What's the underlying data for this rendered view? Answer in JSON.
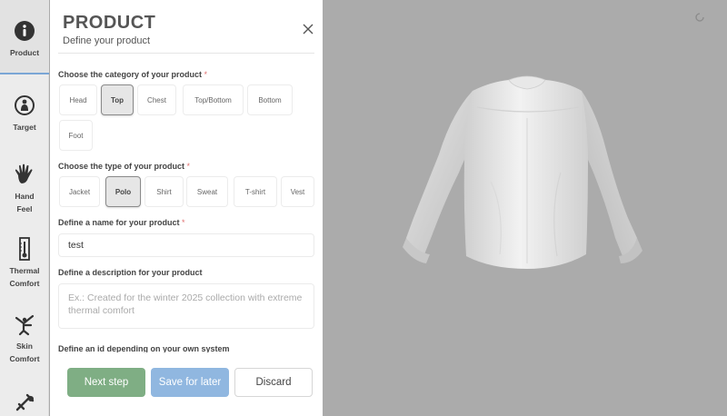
{
  "nav": {
    "items": [
      {
        "label": "Product",
        "icon": "info-icon",
        "active": true
      },
      {
        "label": "Target",
        "icon": "person-target-icon"
      },
      {
        "label": "Hand\nFeel",
        "icon": "hand-icon"
      },
      {
        "label": "Thermal\nComfort",
        "icon": "thermometer-icon"
      },
      {
        "label": "Skin\nComfort",
        "icon": "skin-icon"
      },
      {
        "label": "",
        "icon": "tools-icon"
      }
    ]
  },
  "panel": {
    "title": "PRODUCT",
    "subtitle": "Define your product",
    "category": {
      "label": "Choose the category of your product",
      "required_mark": "*",
      "options": [
        "Head",
        "Top",
        "Chest",
        "Top/Bottom",
        "Bottom",
        "Foot"
      ],
      "selected": "Top"
    },
    "type": {
      "label": "Choose the type of your product",
      "required_mark": "*",
      "options": [
        "Jacket",
        "Polo",
        "Shirt",
        "Sweat",
        "T-shirt",
        "Vest"
      ],
      "selected": "Polo"
    },
    "name": {
      "label": "Define a name for your product",
      "required_mark": "*",
      "value": "test"
    },
    "description": {
      "label": "Define a description for your product",
      "placeholder": "Ex.: Created for the winter 2025 collection with extreme thermal comfort",
      "value": ""
    },
    "id_section": {
      "label": "Define an id depending on your own system"
    },
    "buttons": {
      "next": "Next step",
      "save": "Save for later",
      "discard": "Discard"
    }
  },
  "colors": {
    "accent_green": "#7fae84",
    "accent_blue": "#90b7e0",
    "required": "#e07070",
    "viewer_bg": "#ababab"
  }
}
